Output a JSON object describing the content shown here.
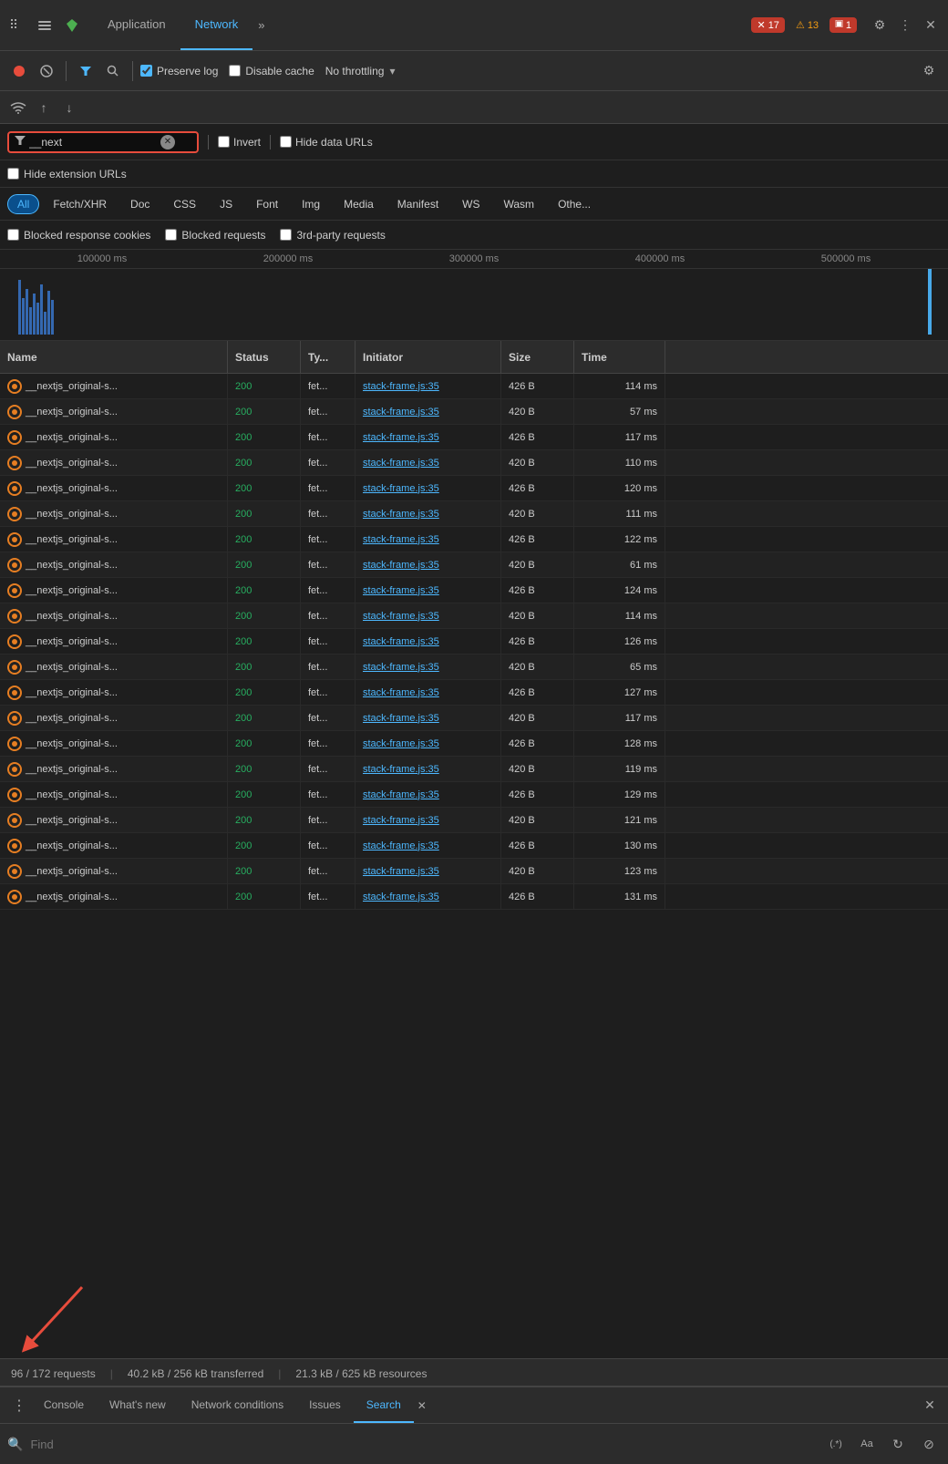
{
  "tabbar": {
    "icon_cursor": "⊹",
    "icon_layers": "⬜",
    "icon_gem": "◆",
    "tab_application": "Application",
    "tab_network": "Network",
    "tab_more": "»",
    "error_count": "17",
    "warn_count": "13",
    "info_count": "1",
    "icon_settings": "⚙",
    "icon_more": "⋮",
    "icon_close": "✕"
  },
  "toolbar": {
    "icon_stop": "⏺",
    "icon_clear": "⊘",
    "icon_filter": "⋁",
    "icon_search": "🔍",
    "preserve_log_label": "Preserve log",
    "preserve_log_checked": true,
    "disable_cache_label": "Disable cache",
    "disable_cache_checked": false,
    "throttle_value": "No throttling",
    "icon_throttle_arrow": "▾",
    "icon_network_settings": "⚙"
  },
  "toolbar2": {
    "icon_wifi": "📶",
    "icon_up": "↑",
    "icon_down": "↓"
  },
  "filter_bar": {
    "filter_icon": "⋁",
    "filter_value": "__next",
    "invert_label": "Invert",
    "invert_checked": false,
    "hide_data_urls_label": "Hide data URLs",
    "hide_data_urls_checked": false
  },
  "hide_ext_bar": {
    "label": "Hide extension URLs",
    "checked": false
  },
  "type_filters": {
    "buttons": [
      {
        "label": "All",
        "active": true
      },
      {
        "label": "Fetch/XHR",
        "active": false
      },
      {
        "label": "Doc",
        "active": false
      },
      {
        "label": "CSS",
        "active": false
      },
      {
        "label": "JS",
        "active": false
      },
      {
        "label": "Font",
        "active": false
      },
      {
        "label": "Img",
        "active": false
      },
      {
        "label": "Media",
        "active": false
      },
      {
        "label": "Manifest",
        "active": false
      },
      {
        "label": "WS",
        "active": false
      },
      {
        "label": "Wasm",
        "active": false
      },
      {
        "label": "Othe...",
        "active": false
      }
    ]
  },
  "blocked_bar": {
    "blocked_cookies_label": "Blocked response cookies",
    "blocked_cookies_checked": false,
    "blocked_requests_label": "Blocked requests",
    "blocked_requests_checked": false,
    "third_party_label": "3rd-party requests",
    "third_party_checked": false
  },
  "timeline": {
    "labels": [
      "100000 ms",
      "200000 ms",
      "300000 ms",
      "400000 ms",
      "500000 ms"
    ]
  },
  "table": {
    "headers": [
      "Name",
      "Status",
      "Ty...",
      "Initiator",
      "Size",
      "Time",
      ""
    ],
    "rows": [
      {
        "name": "__nextjs_original-s...",
        "status": "200",
        "type": "fet...",
        "initiator": "stack-frame.js:35",
        "size": "426 B",
        "time": "114 ms"
      },
      {
        "name": "__nextjs_original-s...",
        "status": "200",
        "type": "fet...",
        "initiator": "stack-frame.js:35",
        "size": "420 B",
        "time": "57 ms"
      },
      {
        "name": "__nextjs_original-s...",
        "status": "200",
        "type": "fet...",
        "initiator": "stack-frame.js:35",
        "size": "426 B",
        "time": "117 ms"
      },
      {
        "name": "__nextjs_original-s...",
        "status": "200",
        "type": "fet...",
        "initiator": "stack-frame.js:35",
        "size": "420 B",
        "time": "110 ms"
      },
      {
        "name": "__nextjs_original-s...",
        "status": "200",
        "type": "fet...",
        "initiator": "stack-frame.js:35",
        "size": "426 B",
        "time": "120 ms"
      },
      {
        "name": "__nextjs_original-s...",
        "status": "200",
        "type": "fet...",
        "initiator": "stack-frame.js:35",
        "size": "420 B",
        "time": "111 ms"
      },
      {
        "name": "__nextjs_original-s...",
        "status": "200",
        "type": "fet...",
        "initiator": "stack-frame.js:35",
        "size": "426 B",
        "time": "122 ms"
      },
      {
        "name": "__nextjs_original-s...",
        "status": "200",
        "type": "fet...",
        "initiator": "stack-frame.js:35",
        "size": "420 B",
        "time": "61 ms"
      },
      {
        "name": "__nextjs_original-s...",
        "status": "200",
        "type": "fet...",
        "initiator": "stack-frame.js:35",
        "size": "426 B",
        "time": "124 ms"
      },
      {
        "name": "__nextjs_original-s...",
        "status": "200",
        "type": "fet...",
        "initiator": "stack-frame.js:35",
        "size": "420 B",
        "time": "114 ms"
      },
      {
        "name": "__nextjs_original-s...",
        "status": "200",
        "type": "fet...",
        "initiator": "stack-frame.js:35",
        "size": "426 B",
        "time": "126 ms"
      },
      {
        "name": "__nextjs_original-s...",
        "status": "200",
        "type": "fet...",
        "initiator": "stack-frame.js:35",
        "size": "420 B",
        "time": "65 ms"
      },
      {
        "name": "__nextjs_original-s...",
        "status": "200",
        "type": "fet...",
        "initiator": "stack-frame.js:35",
        "size": "426 B",
        "time": "127 ms"
      },
      {
        "name": "__nextjs_original-s...",
        "status": "200",
        "type": "fet...",
        "initiator": "stack-frame.js:35",
        "size": "420 B",
        "time": "117 ms"
      },
      {
        "name": "__nextjs_original-s...",
        "status": "200",
        "type": "fet...",
        "initiator": "stack-frame.js:35",
        "size": "426 B",
        "time": "128 ms"
      },
      {
        "name": "__nextjs_original-s...",
        "status": "200",
        "type": "fet...",
        "initiator": "stack-frame.js:35",
        "size": "420 B",
        "time": "119 ms"
      },
      {
        "name": "__nextjs_original-s...",
        "status": "200",
        "type": "fet...",
        "initiator": "stack-frame.js:35",
        "size": "426 B",
        "time": "129 ms"
      },
      {
        "name": "__nextjs_original-s...",
        "status": "200",
        "type": "fet...",
        "initiator": "stack-frame.js:35",
        "size": "420 B",
        "time": "121 ms"
      },
      {
        "name": "__nextjs_original-s...",
        "status": "200",
        "type": "fet...",
        "initiator": "stack-frame.js:35",
        "size": "426 B",
        "time": "130 ms"
      },
      {
        "name": "__nextjs_original-s...",
        "status": "200",
        "type": "fet...",
        "initiator": "stack-frame.js:35",
        "size": "420 B",
        "time": "123 ms"
      },
      {
        "name": "__nextjs_original-s...",
        "status": "200",
        "type": "fet...",
        "initiator": "stack-frame.js:35",
        "size": "426 B",
        "time": "131 ms"
      }
    ]
  },
  "status_bar": {
    "requests": "96 / 172 requests",
    "transferred": "40.2 kB / 256 kB transferred",
    "resources": "21.3 kB / 625 kB resources"
  },
  "bottom_panel": {
    "icon_dots": "⋮",
    "tab_console": "Console",
    "tab_whatsnew": "What's new",
    "tab_network_conditions": "Network conditions",
    "tab_issues": "Issues",
    "tab_search": "Search",
    "tab_close": "✕",
    "close_icon": "✕",
    "find_placeholder": "Find",
    "find_icon_regex": "(.*)",
    "find_icon_case": "Aa",
    "find_icon_refresh": "↻",
    "find_icon_clear": "⊘"
  }
}
